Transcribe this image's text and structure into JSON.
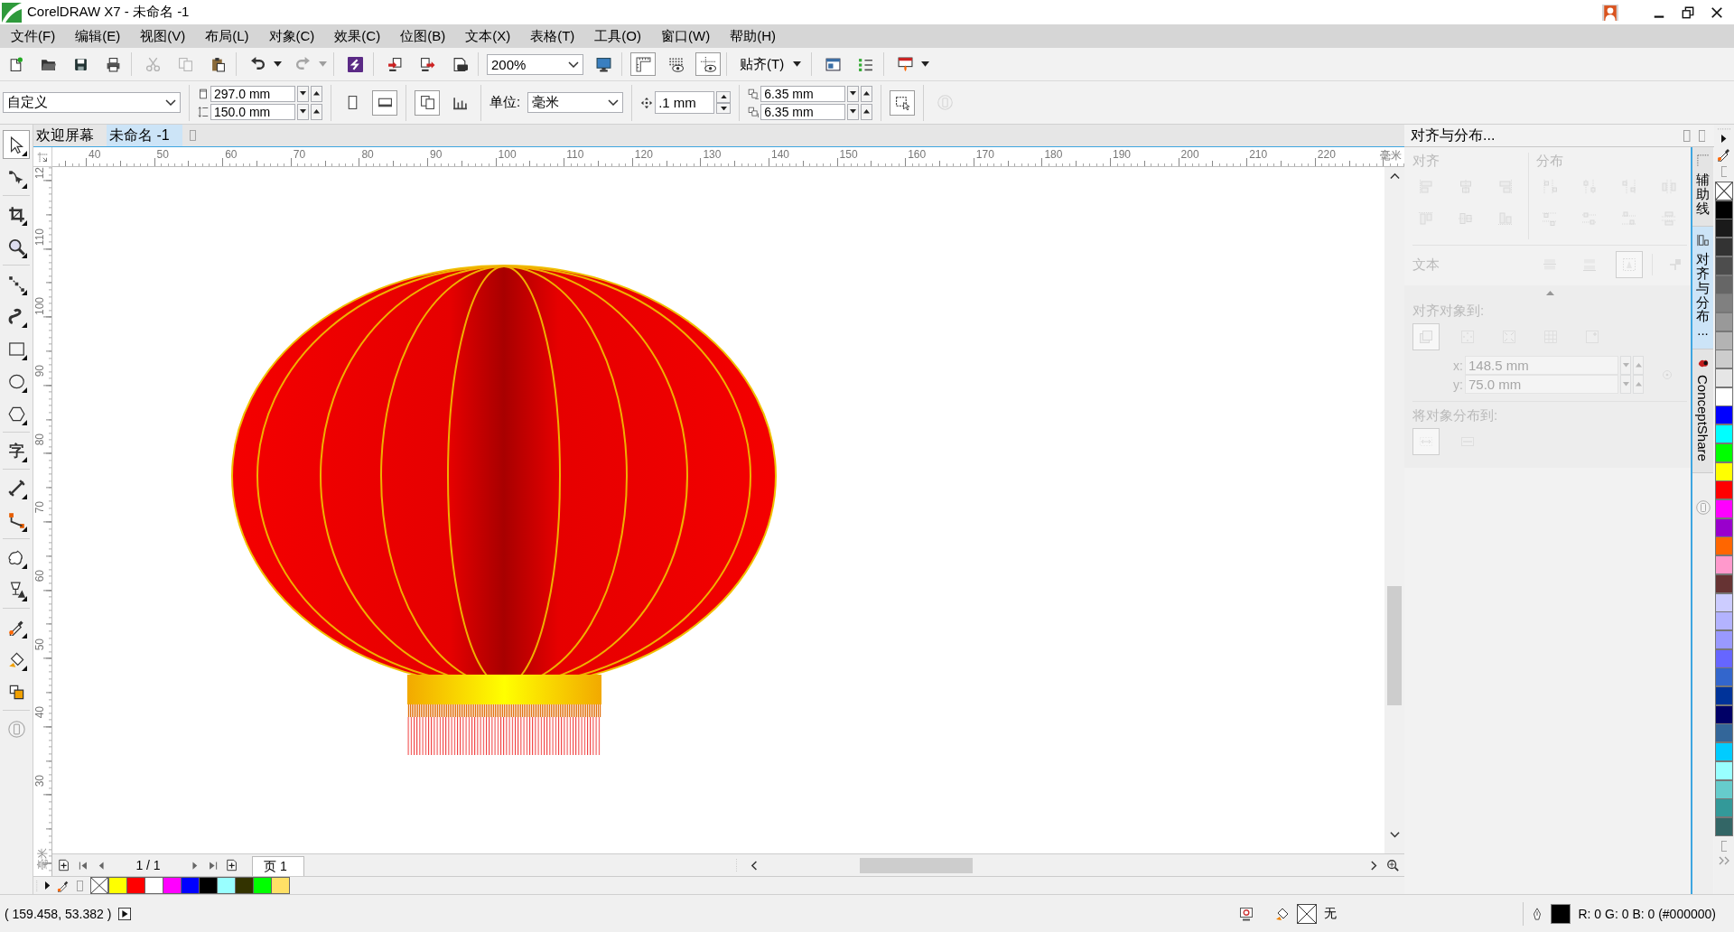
{
  "window": {
    "title": "CorelDRAW X7 - 未命名 -1"
  },
  "menu": [
    "文件(F)",
    "编辑(E)",
    "视图(V)",
    "布局(L)",
    "对象(C)",
    "效果(C)",
    "位图(B)",
    "文本(X)",
    "表格(T)",
    "工具(O)",
    "窗口(W)",
    "帮助(H)"
  ],
  "toolbar": {
    "groups": [
      {
        "items": [
          {
            "kind": "new",
            "disabled": false,
            "on": false
          },
          {
            "kind": "open",
            "disabled": false,
            "on": false
          },
          {
            "kind": "save",
            "disabled": false,
            "on": false
          },
          {
            "kind": "print",
            "disabled": false,
            "on": false
          }
        ]
      },
      {
        "items": [
          {
            "kind": "cut",
            "disabled": true,
            "on": false
          },
          {
            "kind": "copy",
            "disabled": true,
            "on": false
          },
          {
            "kind": "paste",
            "disabled": false,
            "on": false
          }
        ]
      },
      {
        "items": [
          {
            "kind": "undo",
            "disabled": false,
            "on": false
          },
          {
            "kind": "caret",
            "disabled": false,
            "on": false
          },
          {
            "kind": "redo",
            "disabled": true,
            "on": false
          },
          {
            "kind": "caret",
            "disabled": true,
            "on": false
          }
        ]
      },
      {
        "items": [
          {
            "kind": "connect",
            "disabled": false,
            "on": false
          }
        ]
      },
      {
        "items": [
          {
            "kind": "import",
            "disabled": false,
            "on": false
          },
          {
            "kind": "export",
            "disabled": false,
            "on": false
          },
          {
            "kind": "publish",
            "disabled": false,
            "on": false
          }
        ]
      },
      {
        "items": [
          {
            "kind": "zoom-combo",
            "value": "200%",
            "disabled": false,
            "on": false
          },
          {
            "kind": "fullscreen",
            "disabled": false,
            "on": false
          }
        ]
      },
      {
        "items": [
          {
            "kind": "rulers",
            "disabled": false,
            "on": true
          },
          {
            "kind": "grid",
            "disabled": false,
            "on": false
          },
          {
            "kind": "guides",
            "disabled": false,
            "on": true
          }
        ]
      },
      {
        "items": [
          {
            "kind": "snap-menu",
            "label": "贴齐(T)",
            "disabled": false,
            "on": false
          }
        ]
      },
      {
        "items": [
          {
            "kind": "options",
            "disabled": false,
            "on": false
          },
          {
            "kind": "list",
            "disabled": false,
            "on": false
          }
        ]
      },
      {
        "items": [
          {
            "kind": "launch",
            "disabled": false,
            "on": false
          },
          {
            "kind": "caret",
            "disabled": false,
            "on": false
          }
        ]
      }
    ]
  },
  "property_bar": {
    "groups": [
      {
        "items": [
          {
            "kind": "preset-combo",
            "value": "自定义",
            "disabled": false,
            "on": false
          }
        ]
      },
      {
        "items": [
          {
            "kind": "spin-pair",
            "rows": [
              {
                "kind": "width",
                "value": "297.0 mm"
              },
              {
                "kind": "height",
                "value": "150.0 mm"
              }
            ],
            "disabled": false,
            "on": false
          }
        ]
      },
      {
        "items": [
          {
            "kind": "portrait",
            "disabled": false,
            "on": false
          },
          {
            "kind": "landscape",
            "disabled": false,
            "on": true
          }
        ]
      },
      {
        "items": [
          {
            "kind": "all-pages",
            "disabled": false,
            "on": true
          },
          {
            "kind": "current-page",
            "disabled": false,
            "on": false
          }
        ]
      },
      {
        "items": [
          {
            "kind": "unit-combo",
            "label": "单位:",
            "value": "毫米",
            "disabled": false,
            "on": false
          }
        ]
      },
      {
        "items": [
          {
            "kind": "spin",
            "rows": [
              {
                "kind": "nudge",
                "value": ".1 mm"
              }
            ],
            "disabled": false,
            "on": false
          }
        ]
      },
      {
        "items": [
          {
            "kind": "spin-pair",
            "rows": [
              {
                "kind": "dup-x",
                "value": "6.35 mm"
              },
              {
                "kind": "dup-y",
                "value": "6.35 mm"
              }
            ],
            "disabled": false,
            "on": false
          }
        ]
      },
      {
        "items": [
          {
            "kind": "treat-filled",
            "disabled": false,
            "on": true
          }
        ]
      },
      {
        "items": [
          {
            "kind": "device",
            "disabled": true,
            "on": false
          }
        ]
      }
    ]
  },
  "toolbox": {
    "groups": [
      {
        "tools": [
          {
            "kind": "pick",
            "selected": true,
            "flyout": true
          },
          {
            "kind": "shape",
            "selected": false,
            "flyout": true
          }
        ]
      },
      {
        "tools": [
          {
            "kind": "crop",
            "selected": false,
            "flyout": true
          },
          {
            "kind": "zoom",
            "selected": false,
            "flyout": true
          }
        ]
      },
      {
        "tools": [
          {
            "kind": "freehand",
            "selected": false,
            "flyout": true
          },
          {
            "kind": "artistic-media",
            "selected": false,
            "flyout": true
          },
          {
            "kind": "rectangle",
            "selected": false,
            "flyout": true
          },
          {
            "kind": "ellipse",
            "selected": false,
            "flyout": true
          },
          {
            "kind": "polygon",
            "selected": false,
            "flyout": true
          }
        ]
      },
      {
        "tools": [
          {
            "kind": "text",
            "glyph": "字",
            "selected": false,
            "flyout": true
          }
        ]
      },
      {
        "tools": [
          {
            "kind": "dimension",
            "selected": false,
            "flyout": true
          },
          {
            "kind": "connector",
            "selected": false,
            "flyout": true
          }
        ]
      },
      {
        "tools": [
          {
            "kind": "blend",
            "selected": false,
            "flyout": true
          },
          {
            "kind": "transparency",
            "selected": false,
            "flyout": true
          }
        ]
      },
      {
        "tools": [
          {
            "kind": "eyedropper",
            "selected": false,
            "flyout": true
          },
          {
            "kind": "interactive-fill",
            "selected": false,
            "flyout": true
          },
          {
            "kind": "smart-fill",
            "selected": false,
            "flyout": false
          }
        ]
      },
      {
        "tools": [
          {
            "kind": "device",
            "selected": false,
            "flyout": false
          }
        ]
      }
    ]
  },
  "document_tabs": [
    {
      "label": "欢迎屏幕",
      "selected": false
    },
    {
      "label": "未命名 -1",
      "selected": true
    }
  ],
  "rulers": {
    "horizontal": {
      "labels": [
        "40",
        "50",
        "60",
        "70",
        "80",
        "90",
        "100",
        "110",
        "120",
        "130",
        "140",
        "150",
        "160",
        "170",
        "180",
        "190",
        "200",
        "210",
        "220"
      ],
      "unit": "毫米"
    },
    "vertical": {
      "labels": [
        "12",
        "110",
        "100",
        "90",
        "80",
        "70",
        "60",
        "50",
        "40",
        "30"
      ],
      "unit": "毫米"
    }
  },
  "canvas": {
    "objects": [
      {
        "kind": "lantern"
      }
    ]
  },
  "page_navigator": {
    "counter": "1 / 1",
    "pages": [
      {
        "label": "页 1",
        "selected": true
      }
    ]
  },
  "document_palette": {
    "swatches": [
      {
        "kind": "none"
      },
      {
        "kind": "swatch",
        "color": "#ffff00"
      },
      {
        "kind": "swatch",
        "color": "#ff0000"
      },
      {
        "kind": "swatch",
        "color": "#ffffff"
      },
      {
        "kind": "swatch",
        "color": "#ff00ff"
      },
      {
        "kind": "swatch",
        "color": "#0000ff"
      },
      {
        "kind": "swatch",
        "color": "#000000"
      },
      {
        "kind": "swatch",
        "color": "#99ffff"
      },
      {
        "kind": "swatch",
        "color": "#333300"
      },
      {
        "kind": "swatch",
        "color": "#00ff00"
      },
      {
        "kind": "swatch",
        "color": "#ffe066"
      }
    ]
  },
  "docker": {
    "title": "对齐与分布...",
    "disabled": true,
    "align": {
      "heading": "对齐",
      "buttons": [
        {
          "kind": "align-left"
        },
        {
          "kind": "align-hcenter"
        },
        {
          "kind": "align-right"
        },
        {
          "kind": "align-top"
        },
        {
          "kind": "align-vcenter"
        },
        {
          "kind": "align-bottom"
        }
      ]
    },
    "distribute": {
      "heading": "分布",
      "buttons": [
        {
          "kind": "dist-left"
        },
        {
          "kind": "dist-hcenter"
        },
        {
          "kind": "dist-right"
        },
        {
          "kind": "dist-hspace"
        },
        {
          "kind": "dist-top"
        },
        {
          "kind": "dist-vcenter"
        },
        {
          "kind": "dist-bottom"
        },
        {
          "kind": "dist-vspace"
        }
      ]
    },
    "text": {
      "label": "文本",
      "buttons": [
        {
          "kind": "first-line",
          "selected": false
        },
        {
          "kind": "last-line",
          "selected": false
        },
        {
          "kind": "bounding-box",
          "selected": true
        },
        {
          "kind": "outline",
          "selected": false
        }
      ]
    },
    "align_to": {
      "label": "对齐对象到:",
      "buttons": [
        {
          "kind": "active-objects",
          "selected": true
        },
        {
          "kind": "page-edge",
          "selected": false
        },
        {
          "kind": "page-center",
          "selected": false
        },
        {
          "kind": "grid-align",
          "selected": false
        },
        {
          "kind": "point",
          "selected": false
        }
      ],
      "fields": [
        {
          "label": "x:",
          "value": "148.5 mm"
        },
        {
          "label": "y:",
          "value": "75.0 mm"
        }
      ]
    },
    "distribute_to": {
      "label": "将对象分布到:",
      "buttons": [
        {
          "kind": "selection-extent",
          "selected": true
        },
        {
          "kind": "page-extent",
          "selected": false
        }
      ]
    }
  },
  "docker_tabs": [
    {
      "kind": "guides",
      "label": "辅助线",
      "selected": false
    },
    {
      "kind": "align",
      "label": "对齐与分布...",
      "selected": true
    },
    {
      "kind": "conceptshare",
      "label": "ConceptShare",
      "selected": false
    }
  ],
  "color_palette": {
    "swatches": [
      {
        "kind": "none"
      },
      {
        "kind": "swatch",
        "color": "#000000"
      },
      {
        "kind": "swatch",
        "color": "#1a1a1a"
      },
      {
        "kind": "swatch",
        "color": "#333333"
      },
      {
        "kind": "swatch",
        "color": "#4d4d4d"
      },
      {
        "kind": "swatch",
        "color": "#666666"
      },
      {
        "kind": "swatch",
        "color": "#808080"
      },
      {
        "kind": "swatch",
        "color": "#999999"
      },
      {
        "kind": "swatch",
        "color": "#b3b3b3"
      },
      {
        "kind": "swatch",
        "color": "#cccccc"
      },
      {
        "kind": "swatch",
        "color": "#e6e6e6"
      },
      {
        "kind": "swatch",
        "color": "#ffffff"
      },
      {
        "kind": "swatch",
        "color": "#0000ff"
      },
      {
        "kind": "swatch",
        "color": "#00ffff"
      },
      {
        "kind": "swatch",
        "color": "#00ff00"
      },
      {
        "kind": "swatch",
        "color": "#ffff00"
      },
      {
        "kind": "swatch",
        "color": "#ff0000"
      },
      {
        "kind": "swatch",
        "color": "#ff00ff"
      },
      {
        "kind": "swatch",
        "color": "#9900cc"
      },
      {
        "kind": "swatch",
        "color": "#ff6600"
      },
      {
        "kind": "swatch",
        "color": "#ff99cc"
      },
      {
        "kind": "swatch",
        "color": "#663333"
      },
      {
        "kind": "swatch",
        "color": "#ccccff"
      },
      {
        "kind": "swatch",
        "color": "#b3b3ff"
      },
      {
        "kind": "swatch",
        "color": "#9999ff"
      },
      {
        "kind": "swatch",
        "color": "#6666ff"
      },
      {
        "kind": "swatch",
        "color": "#3366cc"
      },
      {
        "kind": "swatch",
        "color": "#003399"
      },
      {
        "kind": "swatch",
        "color": "#000066"
      },
      {
        "kind": "swatch",
        "color": "#336699"
      },
      {
        "kind": "swatch",
        "color": "#00ccff"
      },
      {
        "kind": "swatch",
        "color": "#99ffff"
      },
      {
        "kind": "swatch",
        "color": "#66cccc"
      },
      {
        "kind": "swatch",
        "color": "#339999"
      },
      {
        "kind": "swatch",
        "color": "#336666"
      }
    ]
  },
  "status_bar": {
    "coordinates": "( 159.458, 53.382 )",
    "fill": {
      "kind": "none",
      "label": "无"
    },
    "outline": {
      "color": "#000000",
      "label": "R: 0 G: 0 B: 0 (#000000)"
    }
  }
}
